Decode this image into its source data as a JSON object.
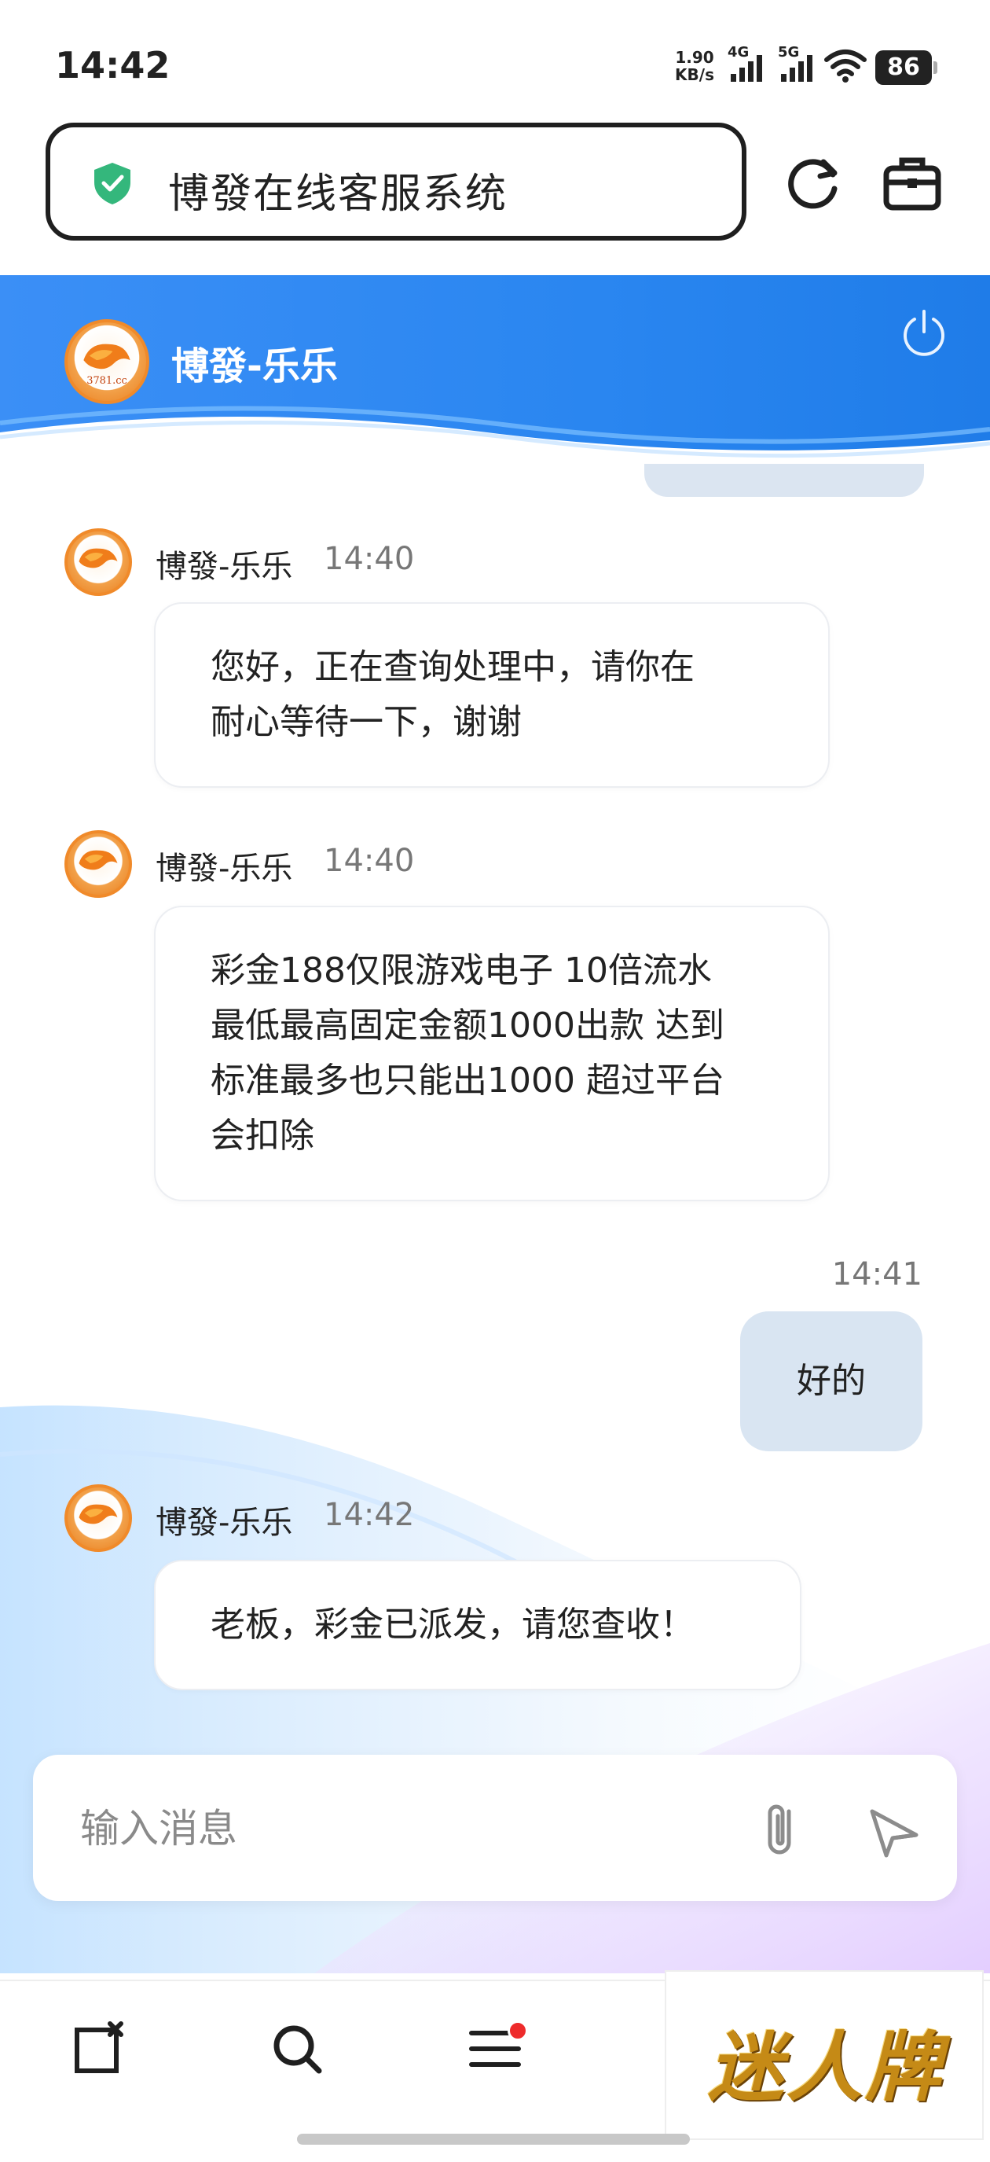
{
  "status_bar": {
    "time": "14:42",
    "net_speed_value": "1.90",
    "net_speed_unit": "KB/s",
    "signal_1": "4G",
    "signal_2": "5G",
    "battery": "86"
  },
  "browser": {
    "title": "博發在线客服系统",
    "secure_icon": "shield-check-icon",
    "reload_icon": "reload-icon",
    "toolbox_icon": "briefcase-icon"
  },
  "chat_header": {
    "agent_name": "博發-乐乐",
    "avatar_text": "3781.cc",
    "power_icon": "power-icon",
    "background_color": "#2a86f0"
  },
  "messages": [
    {
      "side": "left",
      "sender": "博發-乐乐",
      "time": "14:40",
      "lines": [
        "您好，正在查询处理中，请你在",
        "耐心等待一下，谢谢"
      ]
    },
    {
      "side": "left",
      "sender": "博發-乐乐",
      "time": "14:40",
      "lines": [
        "彩金188仅限游戏电子 10倍流水",
        "最低最高固定金额1000出款 达到",
        "标准最多也只能出1000 超过平台",
        "会扣除"
      ]
    },
    {
      "side": "right",
      "time": "14:41",
      "text": "好的"
    },
    {
      "side": "left",
      "sender": "博發-乐乐",
      "time": "14:42",
      "lines": [
        "老板，彩金已派发，请您查收！"
      ]
    }
  ],
  "composer": {
    "placeholder": "输入消息",
    "attach_icon": "paperclip-icon",
    "send_icon": "send-icon"
  },
  "bottom_nav": {
    "items": [
      "close-tab-icon",
      "search-icon",
      "menu-icon"
    ],
    "menu_has_badge": true
  },
  "watermark": "迷人牌"
}
